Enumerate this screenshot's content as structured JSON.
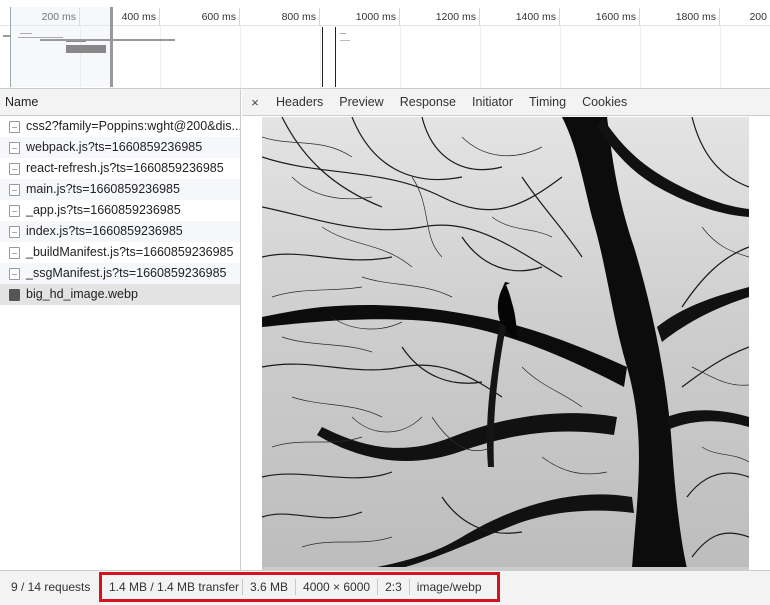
{
  "timeline": {
    "ticks": [
      "200 ms",
      "400 ms",
      "600 ms",
      "800 ms",
      "1000 ms",
      "1200 ms",
      "1400 ms",
      "1600 ms",
      "1800 ms",
      "200"
    ]
  },
  "requests": {
    "header": "Name",
    "items": [
      {
        "name": "css2?family=Poppins:wght@200&dis...",
        "icon": "file-icon"
      },
      {
        "name": "webpack.js?ts=1660859236985",
        "icon": "file-icon"
      },
      {
        "name": "react-refresh.js?ts=1660859236985",
        "icon": "file-icon"
      },
      {
        "name": "main.js?ts=1660859236985",
        "icon": "file-icon"
      },
      {
        "name": "_app.js?ts=1660859236985",
        "icon": "file-icon"
      },
      {
        "name": "index.js?ts=1660859236985",
        "icon": "file-icon"
      },
      {
        "name": "_buildManifest.js?ts=1660859236985",
        "icon": "file-icon"
      },
      {
        "name": "_ssgManifest.js?ts=1660859236985",
        "icon": "file-icon"
      },
      {
        "name": "big_hd_image.webp",
        "icon": "image-file-icon"
      }
    ]
  },
  "detail": {
    "close": "×",
    "tabs": [
      "Headers",
      "Preview",
      "Response",
      "Initiator",
      "Timing",
      "Cookies"
    ]
  },
  "status": {
    "requests": "9 / 14 requests",
    "transferred": "1.4 MB / 1.4 MB transfer",
    "resources": "3.6 MB",
    "dimensions": "4000 × 6000",
    "ratio": "2:3",
    "mime": "image/webp"
  },
  "colors": {
    "highlight_border": "#d6121f"
  }
}
